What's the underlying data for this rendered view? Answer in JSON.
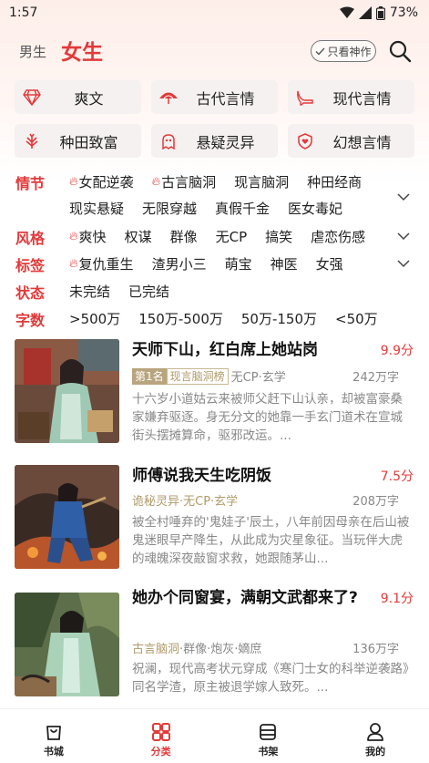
{
  "status_bar": {
    "time": "1:57",
    "battery": "73%"
  },
  "header": {
    "tab_male": "男生",
    "tab_female": "女生",
    "filter_pill": "只看神作"
  },
  "categories": [
    {
      "label": "爽文",
      "icon": "diamond-icon"
    },
    {
      "label": "古代言情",
      "icon": "umbrella-icon"
    },
    {
      "label": "现代言情",
      "icon": "high-heel-icon"
    },
    {
      "label": "种田致富",
      "icon": "wheat-icon"
    },
    {
      "label": "悬疑灵异",
      "icon": "ghost-icon"
    },
    {
      "label": "幻想言情",
      "icon": "shield-heart-icon"
    }
  ],
  "filters": {
    "plot": {
      "label": "情节",
      "row1": [
        "女配逆袭",
        "古言脑洞",
        "现言脑洞",
        "种田经商"
      ],
      "row2": [
        "现实悬疑",
        "无限穿越",
        "真假千金",
        "医女毒妃"
      ]
    },
    "style": {
      "label": "风格",
      "tags": [
        "爽快",
        "权谋",
        "群像",
        "无CP",
        "搞笑",
        "虐恋伤感"
      ]
    },
    "tag": {
      "label": "标签",
      "tags": [
        "复仇重生",
        "渣男小三",
        "萌宝",
        "神医",
        "女强"
      ]
    },
    "status": {
      "label": "状态",
      "tags": [
        "未完结",
        "已完结"
      ]
    },
    "words": {
      "label": "字数",
      "tags": [
        ">500万",
        "150万-500万",
        "50万-150万",
        "<50万"
      ]
    }
  },
  "books": [
    {
      "title": "天师下山，红白席上她站岗",
      "score": "9.9分",
      "rank": "第1名",
      "rank_list": "现言脑洞榜",
      "genre": "无CP·玄学",
      "words": "242万字",
      "desc": "十六岁小道姑云来被师父赶下山认亲，却被富豪桑家嫌弃驱逐。身无分文的她靠一手玄门道术在宣城街头摆摊算命，驱邪改运。..."
    },
    {
      "title": "师傅说我天生吃阴饭",
      "score": "7.5分",
      "genre": "诡秘灵异·无CP·玄学",
      "words": "208万字",
      "desc": "被全村唾弃的'鬼娃子'辰土，八年前因母亲在后山被鬼迷眼早产降生，从此成为灾星象征。当玩伴大虎的魂魄深夜敲窗求救，她跟随茅山..."
    },
    {
      "title": "她办个同窗宴，满朝文武都来了?",
      "score": "9.1分",
      "genre": "古言脑洞",
      "genre_rest": "·群像·炮灰·嫡庶",
      "words": "136万字",
      "desc": "祝澜，现代高考状元穿成《寒门士女的科举逆袭路》同名学渣，原主被退学嫁人致死。..."
    }
  ],
  "bottom_nav": [
    {
      "label": "书城",
      "icon": "bookstore-icon"
    },
    {
      "label": "分类",
      "icon": "category-grid-icon",
      "active": true
    },
    {
      "label": "书架",
      "icon": "bookshelf-icon"
    },
    {
      "label": "我的",
      "icon": "profile-icon"
    }
  ],
  "colors": {
    "accent": "#e23a3a",
    "gold": "#b09a6a",
    "card_bg": "#f5f1f0"
  }
}
